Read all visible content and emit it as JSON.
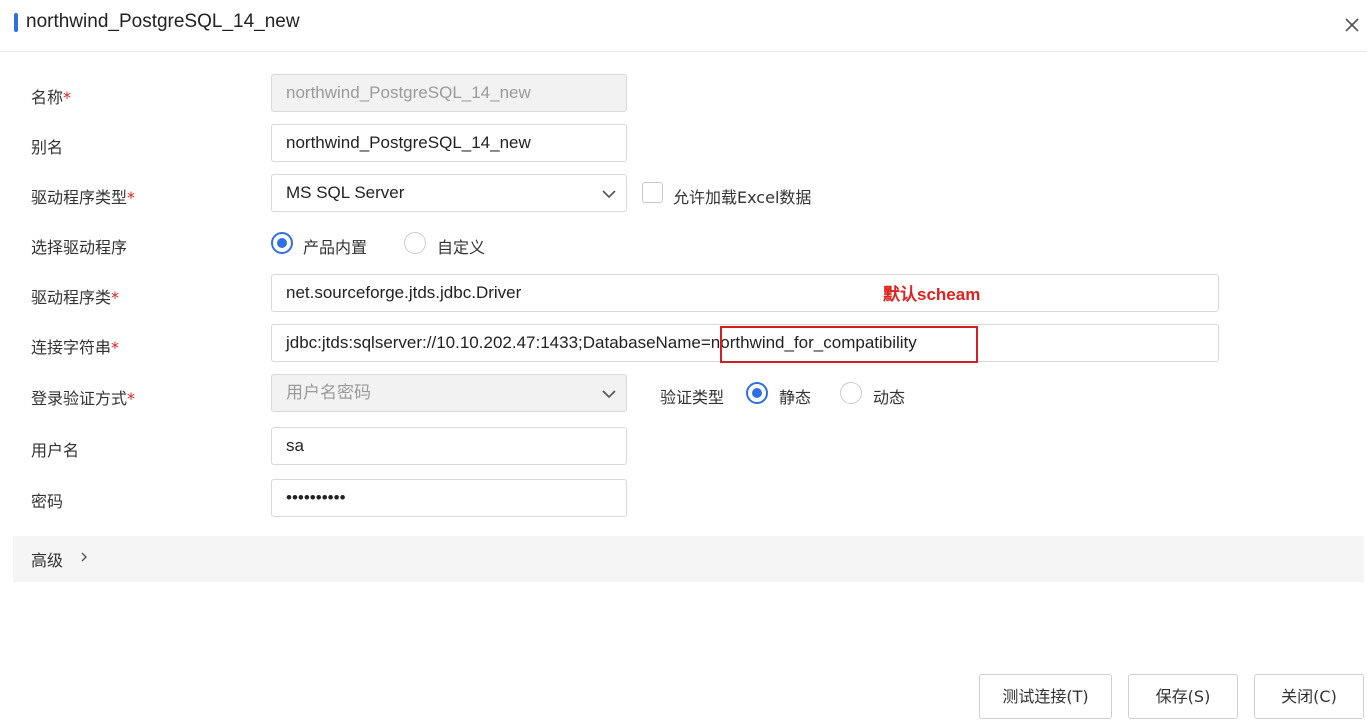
{
  "dialog": {
    "title": "northwind_PostgreSQL_14_new"
  },
  "form": {
    "name": {
      "label": "名称",
      "required": "*",
      "value": "northwind_PostgreSQL_14_new"
    },
    "alias": {
      "label": "别名",
      "value": "northwind_PostgreSQL_14_new"
    },
    "driver_type": {
      "label": "驱动程序类型",
      "required": "*",
      "value": "MS SQL Server"
    },
    "allow_excel": {
      "label": "允许加载Excel数据",
      "checked": false
    },
    "select_driver": {
      "label": "选择驱动程序",
      "options": [
        "产品内置",
        "自定义"
      ],
      "selected": "产品内置"
    },
    "driver_class": {
      "label": "驱动程序类",
      "required": "*",
      "value": "net.sourceforge.jtds.jdbc.Driver"
    },
    "conn_string": {
      "label": "连接字符串",
      "required": "*",
      "value": "jdbc:jtds:sqlserver://10.10.202.47:1433;DatabaseName=northwind_for_compatibility"
    },
    "auth_method": {
      "label": "登录验证方式",
      "required": "*",
      "value": "用户名密码"
    },
    "auth_type": {
      "label": "验证类型",
      "options": [
        "静态",
        "动态"
      ],
      "selected": "静态"
    },
    "username": {
      "label": "用户名",
      "value": "sa"
    },
    "password": {
      "label": "密码",
      "value": "••••••••••"
    }
  },
  "annotation": {
    "text": "默认scheam"
  },
  "advanced": {
    "label": "高级"
  },
  "buttons": {
    "test": "测试连接(T)",
    "save": "保存(S)",
    "close": "关闭(C)"
  },
  "colors": {
    "accent": "#2f6fe4",
    "required": "#e02020",
    "annotation": "#e0211d"
  }
}
